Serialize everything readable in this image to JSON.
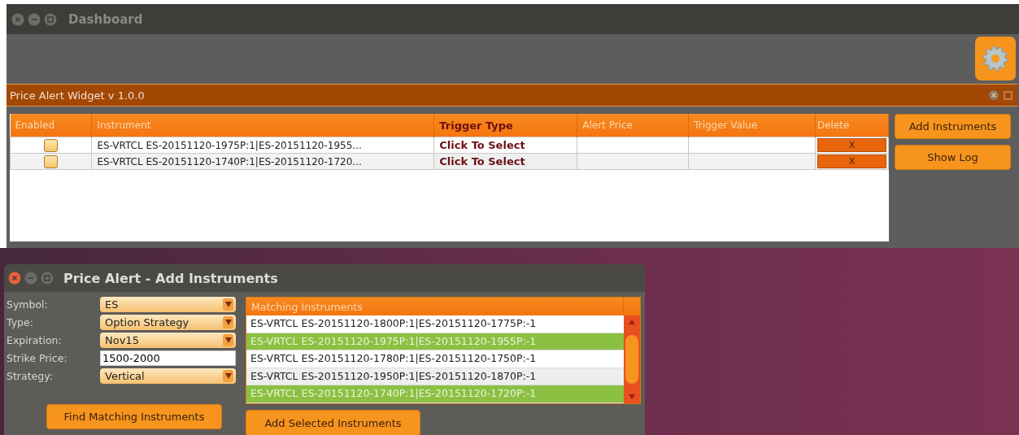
{
  "window": {
    "title": "Dashboard"
  },
  "widget": {
    "title": "Price Alert Widget v 1.0.0"
  },
  "alerts_table": {
    "columns": [
      "Enabled",
      "Instrument",
      "Trigger Type",
      "Alert Price",
      "Trigger Value",
      "Delete"
    ],
    "rows": [
      {
        "enabled": false,
        "instrument": "ES-VRTCL ES-20151120-1975P:1|ES-20151120-1955...",
        "trigger_type": "Click To Select",
        "delete": "X"
      },
      {
        "enabled": false,
        "instrument": "ES-VRTCL ES-20151120-1740P:1|ES-20151120-1720...",
        "trigger_type": "Click To Select",
        "delete": "X"
      }
    ]
  },
  "side_buttons": [
    "Add Instruments",
    "Show Log"
  ],
  "dialog": {
    "title": "Price Alert - Add Instruments",
    "fields": [
      {
        "kind": "dropdown",
        "label": "Symbol:",
        "value": "ES"
      },
      {
        "kind": "dropdown",
        "label": "Type:",
        "value": "Option Strategy"
      },
      {
        "kind": "dropdown",
        "label": "Expiration:",
        "value": "Nov15"
      },
      {
        "kind": "text",
        "label": "Strike Price:",
        "value": "1500-2000"
      },
      {
        "kind": "dropdown",
        "label": "Strategy:",
        "value": "Vertical"
      }
    ],
    "find_button": "Find Matching Instruments",
    "list": {
      "header": "Matching Instruments",
      "items": [
        {
          "text": "ES-VRTCL ES-20151120-1800P:1|ES-20151120-1775P:-1",
          "selected": false
        },
        {
          "text": "ES-VRTCL ES-20151120-1975P:1|ES-20151120-1955P:-1",
          "selected": true
        },
        {
          "text": "ES-VRTCL ES-20151120-1780P:1|ES-20151120-1750P:-1",
          "selected": false
        },
        {
          "text": "ES-VRTCL ES-20151120-1950P:1|ES-20151120-1870P:-1",
          "selected": false
        },
        {
          "text": "ES-VRTCL ES-20151120-1740P:1|ES-20151120-1720P:-1",
          "selected": true
        }
      ]
    },
    "add_button": "Add Selected Instruments"
  }
}
